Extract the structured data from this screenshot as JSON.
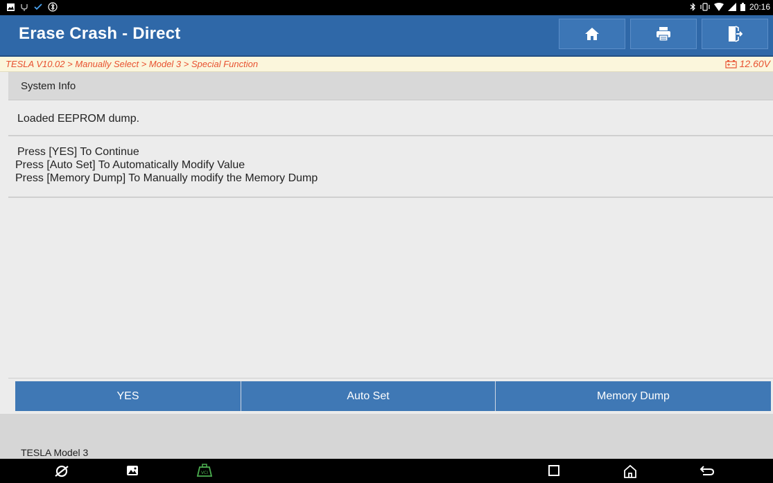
{
  "status_bar": {
    "left_icons": [
      "image-icon",
      "usb-icon",
      "check-icon",
      "bluetooth-alt-icon"
    ],
    "right_icons": [
      "bluetooth-icon",
      "vibrate-icon",
      "wifi-icon",
      "signal-icon",
      "battery-icon"
    ],
    "time": "20:16"
  },
  "header": {
    "title": "Erase Crash - Direct",
    "buttons": [
      {
        "icon": "home-icon"
      },
      {
        "icon": "print-icon"
      },
      {
        "icon": "exit-icon"
      }
    ]
  },
  "breadcrumb": {
    "path": "TESLA V10.02 > Manually Select > Model 3 > Special Function",
    "voltage": "12.60V",
    "accent_color": "#e8502f"
  },
  "system_info": {
    "label": "System Info"
  },
  "messages": {
    "message1": "Loaded EEPROM dump.",
    "message2_lines": [
      "Press [YES] To Continue",
      "Press [Auto Set] To Automatically Modify Value",
      "Press [Memory Dump] To Manually modify the Memory Dump"
    ]
  },
  "actions": {
    "yes": "YES",
    "auto_set": "Auto Set",
    "memory_dump": "Memory Dump"
  },
  "footer": {
    "vehicle": "TESLA Model 3"
  },
  "nav_bar": {
    "icons": [
      "browser-icon",
      "gallery-icon",
      "vci-icon",
      "recent-apps-icon",
      "home-nav-icon",
      "back-icon"
    ],
    "vci_color": "#4caf50"
  },
  "theme": {
    "primary": "#2f68a8",
    "button": "#3f78b5"
  }
}
